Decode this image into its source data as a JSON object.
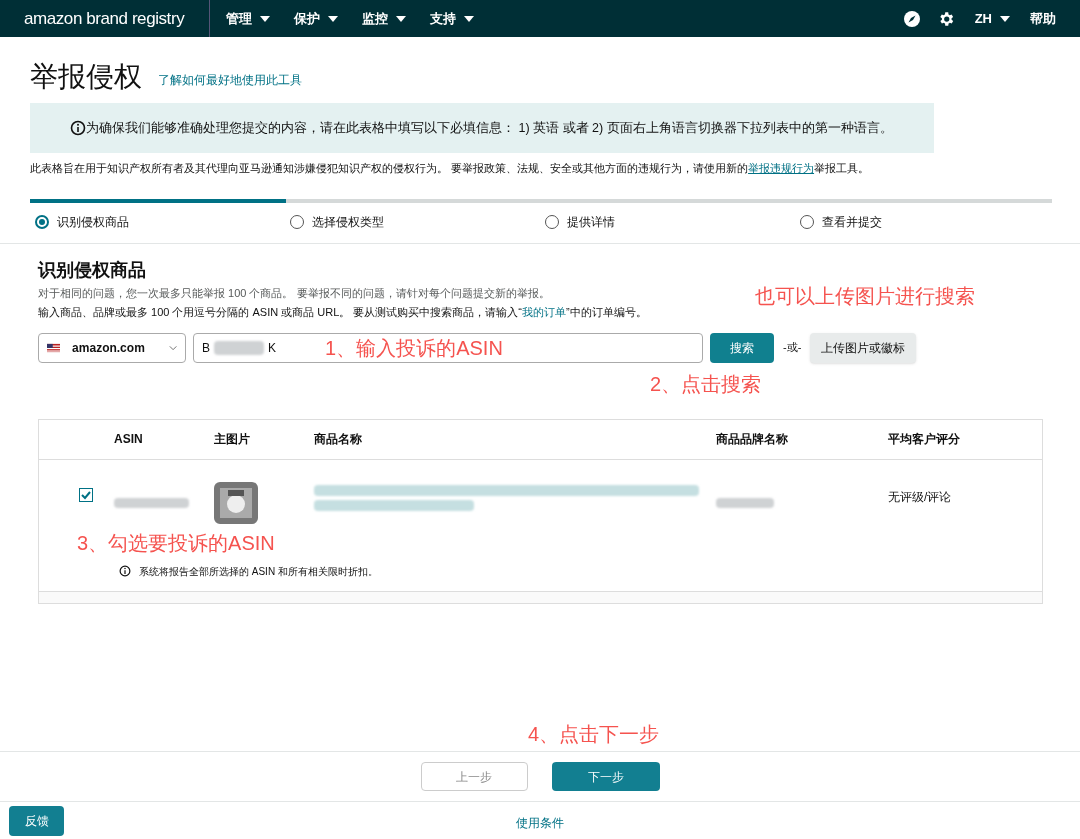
{
  "nav": {
    "logo": "amazon brand registry",
    "menus": [
      {
        "label": "管理"
      },
      {
        "label": "保护"
      },
      {
        "label": "监控"
      },
      {
        "label": "支持"
      }
    ],
    "language": "ZH",
    "help": "帮助"
  },
  "page": {
    "title": "举报侵权",
    "help_link": "了解如何最好地使用此工具"
  },
  "notice": "为确保我们能够准确处理您提交的内容，请在此表格中填写以下必填信息： 1) 英语 或者 2) 页面右上角语言切换器下拉列表中的第一种语言。",
  "description": {
    "before": "此表格旨在用于知识产权所有者及其代理向亚马逊通知涉嫌侵犯知识产权的侵权行为。 要举报政策、法规、安全或其他方面的违规行为，请使用新的",
    "link": "举报违规行为",
    "after": "举报工具。"
  },
  "progress": {
    "level": 0.25
  },
  "steps": [
    {
      "label": "识别侵权商品",
      "selected": true
    },
    {
      "label": "选择侵权类型",
      "selected": false
    },
    {
      "label": "提供详情",
      "selected": false
    },
    {
      "label": "查看并提交",
      "selected": false
    }
  ],
  "section": {
    "title": "识别侵权商品",
    "hint": "对于相同的问题，您一次最多只能举报 100 个商品。 要举报不同的问题，请针对每个问题提交新的举报。",
    "instruction_before": "输入商品、品牌或最多 100 个用逗号分隔的 ASIN 或商品 URL。 要从测试购买中搜索商品，请输入“",
    "instruction_link": "我的订单",
    "instruction_after": "”中的订单编号。"
  },
  "search": {
    "marketplace": "amazon.com",
    "value_start": "B",
    "value_end": "K",
    "button": "搜索",
    "or": "-或-",
    "upload_button": "上传图片或徽标"
  },
  "table": {
    "columns": [
      "ASIN",
      "主图片",
      "商品名称",
      "商品品牌名称",
      "平均客户评分"
    ],
    "rows": [
      {
        "checked": true,
        "rating": "无评级/评论"
      }
    ],
    "note": "系统将报告全部所选择的 ASIN 和所有相关限时折扣。"
  },
  "annotations": [
    "也可以上传图片进行搜索",
    "1、输入投诉的ASIN",
    "2、点击搜索",
    "3、勾选要投诉的ASIN",
    "4、点击下一步"
  ],
  "footer": {
    "back": "上一步",
    "next": "下一步",
    "feedback": "反馈",
    "terms": "使用条件"
  }
}
